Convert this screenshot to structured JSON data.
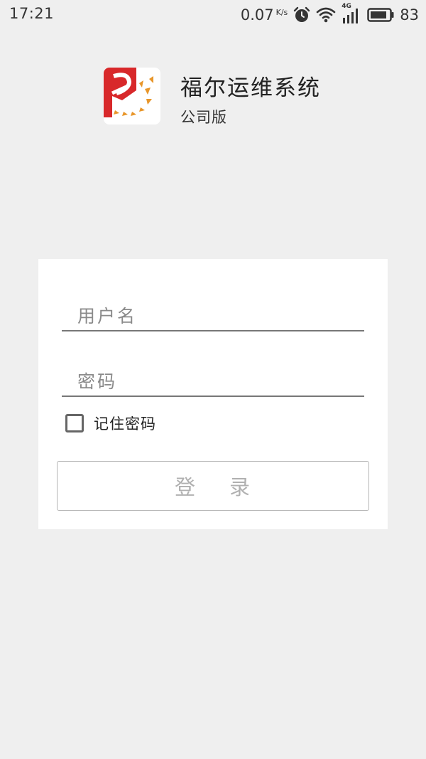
{
  "status_bar": {
    "time": "17:21",
    "net_speed": "0.07",
    "net_unit": "K/s",
    "network_type": "4G",
    "battery_level": "83",
    "icons": [
      "alarm-icon",
      "wifi-icon",
      "signal-icon",
      "battery-icon"
    ]
  },
  "app": {
    "title": "福尔运维系统",
    "subtitle": "公司版",
    "logo_colors": {
      "red": "#d8282a",
      "orange": "#e8962a"
    }
  },
  "login": {
    "username_placeholder": "用户名",
    "username_value": "",
    "password_placeholder": "密码",
    "password_value": "",
    "remember_label": "记住密码",
    "remember_checked": false,
    "login_button_left": "登",
    "login_button_right": "录"
  }
}
